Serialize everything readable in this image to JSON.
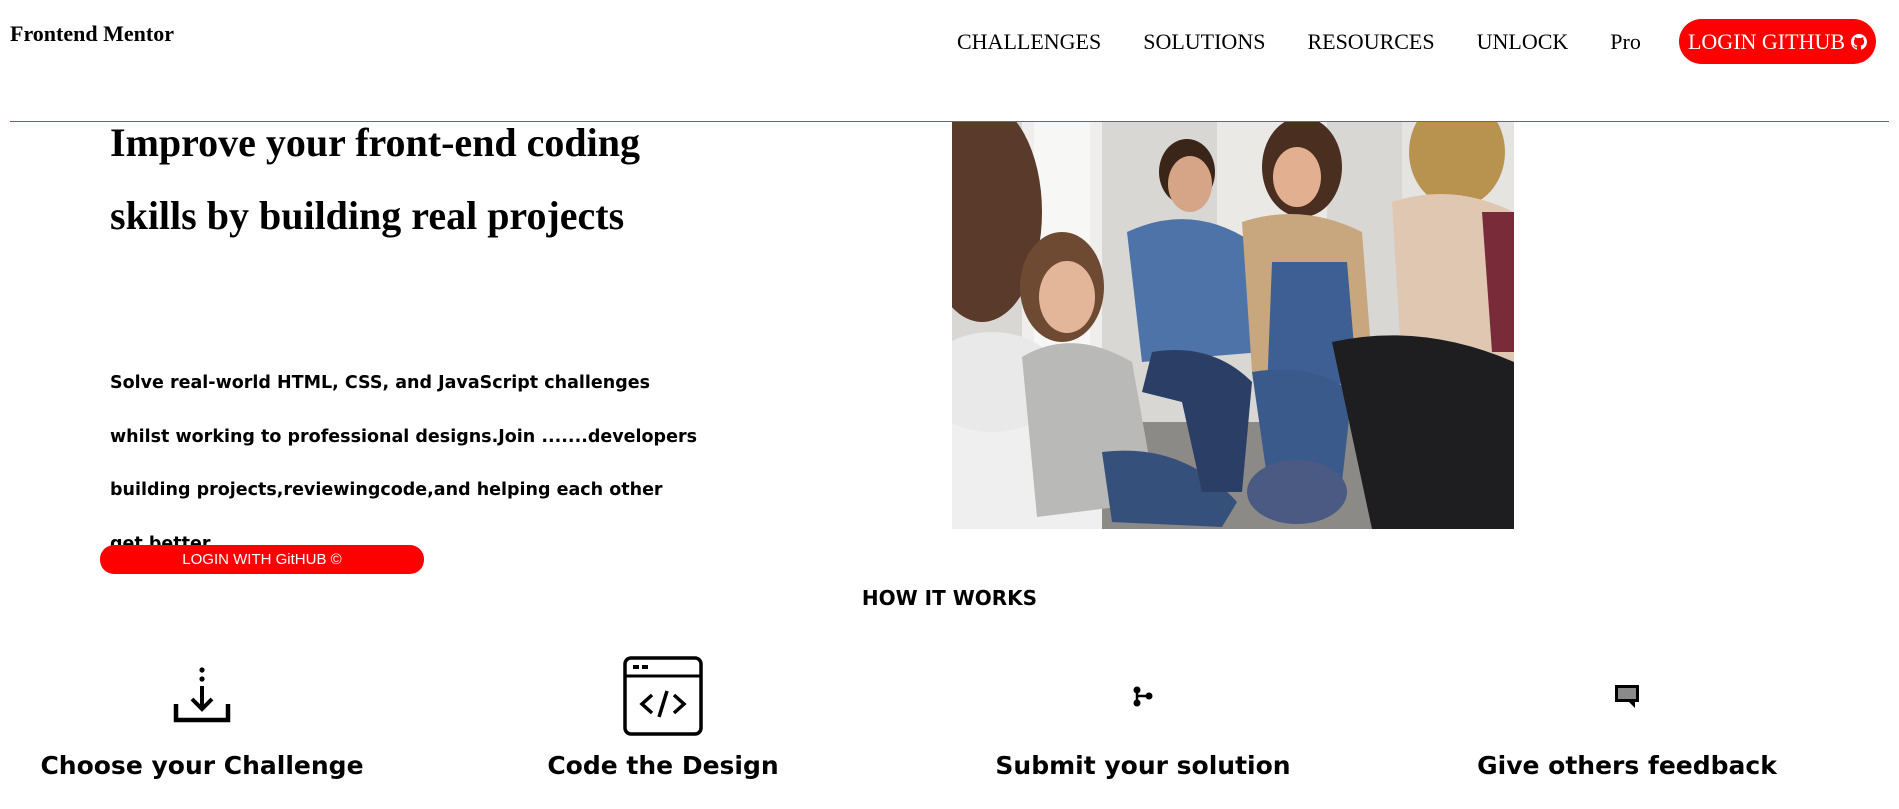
{
  "header": {
    "brand": "Frontend Mentor",
    "nav": [
      {
        "label": "CHALLENGES"
      },
      {
        "label": "SOLUTIONS"
      },
      {
        "label": "RESOURCES"
      },
      {
        "label": "UNLOCK"
      },
      {
        "label": "Pro"
      }
    ],
    "login_button": {
      "label": "LOGIN GITHUB",
      "icon": "github-icon"
    }
  },
  "hero": {
    "title": "Improve your front-end coding skills by building real projects",
    "description": "Solve real-world HTML, CSS, and JavaScript challenges whilst working to professional designs.Join .......developers building projects,reviewingcode,and helping each other get better.",
    "button": {
      "label": "LOGIN WITH GitHUB ©"
    }
  },
  "how_it_works": {
    "title": "HOW IT WORKS",
    "steps": [
      {
        "label": "Choose your Challenge",
        "icon": "download-icon"
      },
      {
        "label": "Code the Design",
        "icon": "code-window-icon"
      },
      {
        "label": "Submit your solution",
        "icon": "git-branch-icon"
      },
      {
        "label": "Give others feedback",
        "icon": "comment-icon"
      }
    ]
  },
  "colors": {
    "accent": "#ff0000",
    "divider": "#ff2a2a",
    "text": "#000000",
    "background": "#ffffff"
  }
}
